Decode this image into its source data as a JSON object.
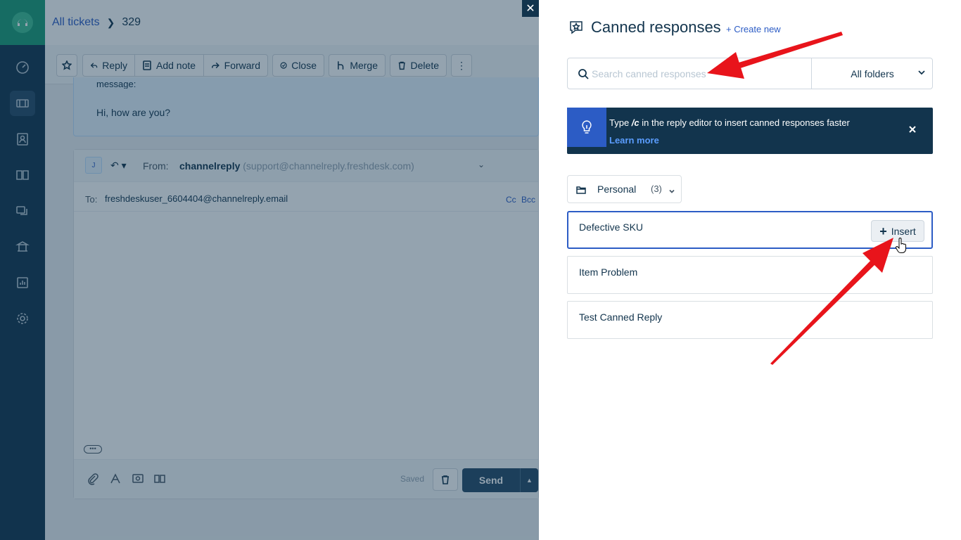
{
  "breadcrumb": {
    "all_tickets": "All tickets",
    "ticket_id": "329"
  },
  "toolbar": {
    "reply": "Reply",
    "add_note": "Add note",
    "forward": "Forward",
    "close": "Close",
    "merge": "Merge",
    "delete": "Delete",
    "more": "⋮"
  },
  "message": {
    "snippet": "message:",
    "text": "Hi, how are you?"
  },
  "editor": {
    "avatar_initial": "J",
    "from_label": "From:",
    "from_name": "channelreply",
    "from_email": "(support@channelreply.freshdesk.com)",
    "to_label": "To:",
    "to_value": "freshdeskuser_6604404@channelreply.email",
    "cc": "Cc",
    "bcc": "Bcc",
    "saved": "Saved",
    "send": "Send",
    "more_dots": "•••"
  },
  "panel": {
    "title": "Canned responses",
    "create_new": "+ Create new",
    "search_placeholder": "Search canned responses",
    "folder_filter": "All folders",
    "tip_prefix": "Type ",
    "tip_shortcut": "/c",
    "tip_suffix": " in the reply editor to insert canned responses faster",
    "tip_link": "Learn more",
    "folder": {
      "name": "Personal",
      "count": "(3)"
    },
    "responses": [
      {
        "title": "Defective SKU"
      },
      {
        "title": "Item Problem"
      },
      {
        "title": "Test Canned Reply"
      }
    ],
    "insert_label": "Insert"
  },
  "close_label": "✕",
  "colors": {
    "nav": "#12344d",
    "brand": "#1a9b76",
    "link": "#2c5cc5",
    "arrow": "#e8141b"
  }
}
